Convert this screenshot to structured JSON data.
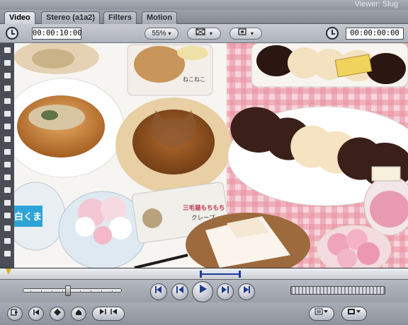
{
  "window": {
    "title": "Viewer: Slug"
  },
  "tabs": [
    {
      "label": "Video",
      "active": true
    },
    {
      "label": "Stereo (a1a2)",
      "active": false
    },
    {
      "label": "Filters",
      "active": false
    },
    {
      "label": "Motion",
      "active": false
    }
  ],
  "toolbar": {
    "duration_timecode": "00:00:10:00",
    "zoom": "55%",
    "zoom_arrow": "▾",
    "view_arrow": "▾",
    "overlay_arrow": "▾",
    "current_timecode": "00:00:00:00"
  },
  "image": {
    "labels": {
      "left_cup": "白くま",
      "crepe_package": "三毛猫もちもち",
      "crepe_sub": "クレープ",
      "cake_top": "ねこねこ"
    },
    "colors": {
      "tablecloth": "#e88fa0",
      "chocolate": "#3b1f19",
      "bun": "#f5e3c2"
    }
  },
  "scrubber": {
    "playhead_fraction": 0.0,
    "in_fraction": 0.49,
    "out_fraction": 0.59
  },
  "transport": {
    "shuttle_position": 0.45,
    "buttons": [
      "go-to-in",
      "previous-edit",
      "play",
      "next-edit",
      "go-to-out"
    ]
  },
  "bottom": {
    "left_buttons": [
      "match-frame",
      "mark-in",
      "add-marker",
      "mark-clip",
      "mark-out"
    ]
  }
}
